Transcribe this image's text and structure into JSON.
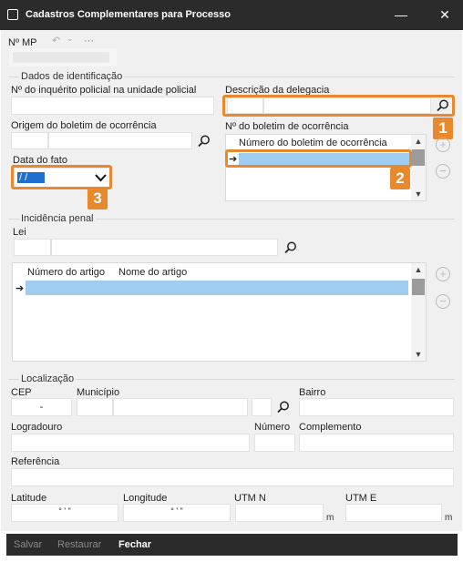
{
  "window": {
    "title": "Cadastros Complementares para Processo",
    "minimize": "—",
    "close": "✕"
  },
  "header": {
    "mp_label": "Nº MP",
    "ellipsis": "···"
  },
  "identification": {
    "group": "Dados de identificação",
    "inquiry_label": "Nº do inquérito policial na unidade policial",
    "delegacia_label": "Descrição da delegacia",
    "origem_label": "Origem do boletim de ocorrência",
    "bo_label": "Nº do boletim de ocorrência",
    "bo_column": "Número do boletim de ocorrência",
    "date_label": "Data do fato",
    "date_value": " / /"
  },
  "penal": {
    "group": "Incidência penal",
    "lei_label": "Lei",
    "col_numero": "Número do artigo",
    "col_nome": "Nome do artigo"
  },
  "location": {
    "group": "Localização",
    "cep_label": "CEP",
    "cep_value": "-",
    "municipio_label": "Município",
    "bairro_label": "Bairro",
    "logradouro_label": "Logradouro",
    "numero_label": "Número",
    "complemento_label": "Complemento",
    "referencia_label": "Referência",
    "latitude_label": "Latitude",
    "latitude_value": "° ' \"",
    "longitude_label": "Longitude",
    "longitude_value": "° ' \"",
    "utmn_label": "UTM N",
    "utme_label": "UTM E",
    "unit_m": "m"
  },
  "badges": [
    "1",
    "2",
    "3"
  ],
  "footer": {
    "salvar": "Salvar",
    "restaurar": "Restaurar",
    "fechar": "Fechar"
  },
  "colors": {
    "accent": "#e7892c",
    "selection": "#9fcdf2",
    "titlebar": "#2b2b2b"
  }
}
